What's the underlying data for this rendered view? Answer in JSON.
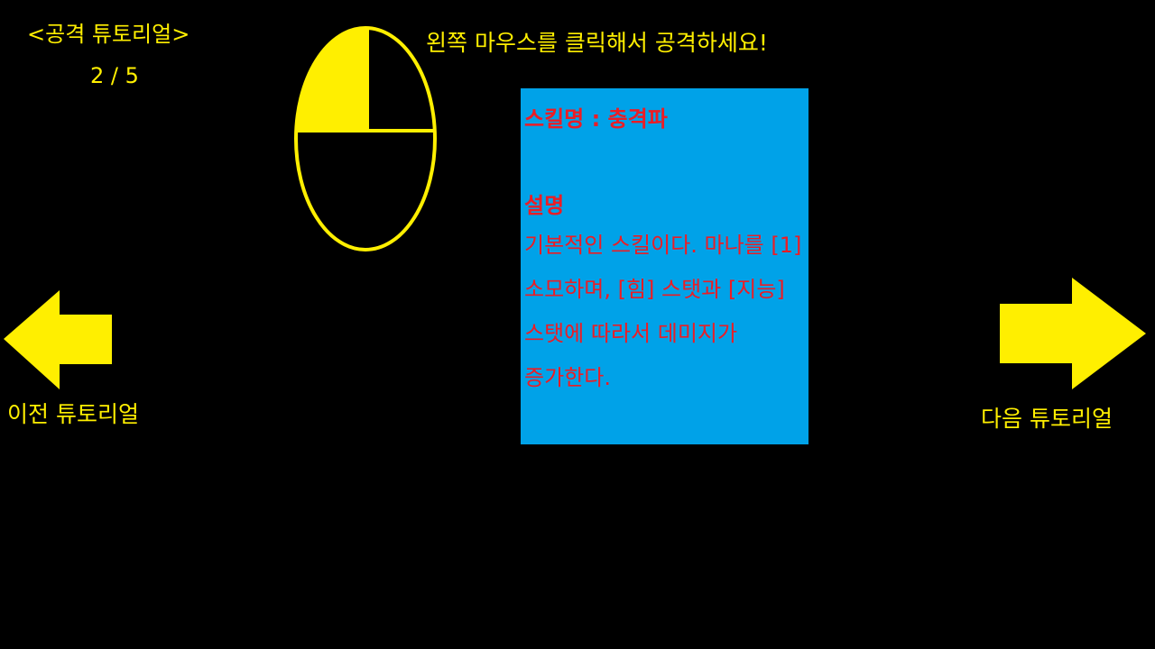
{
  "tutorial": {
    "title": "<공격 튜토리얼>",
    "page": "2 / 5",
    "instruction": "왼쪽 마우스를 클릭해서 공격하세요!"
  },
  "skill_card": {
    "name_line": "스킬명 : 충격파",
    "desc_heading": "설명",
    "desc_body": "기본적인 스킬이다. 마나를 [1] 소모하며, [힘] 스탯과 [지능] 스탯에 따라서 데미지가 증가한다."
  },
  "navigation": {
    "prev_label": "이전 튜토리얼",
    "next_label": "다음 튜토리얼"
  },
  "icons": {
    "mouse": "mouse-left-click-icon",
    "prev": "arrow-left-icon",
    "next": "arrow-right-icon"
  },
  "colors": {
    "background": "#000000",
    "accent_yellow": "#ffef00",
    "card_blue": "#00a2e8",
    "text_red": "#ed1c24"
  }
}
